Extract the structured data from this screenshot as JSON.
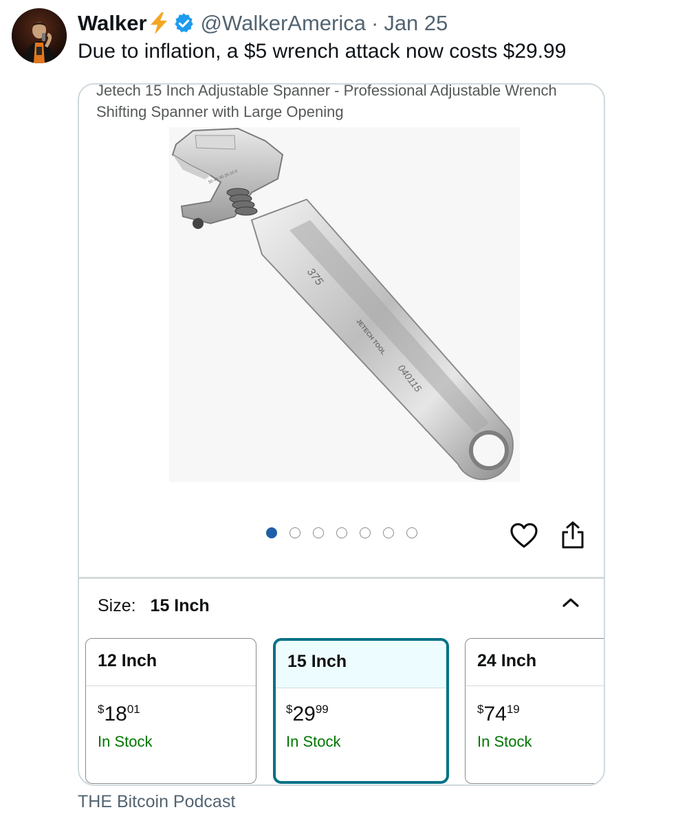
{
  "tweet": {
    "author_name": "Walker",
    "author_handle": "@WalkerAmerica",
    "separator": "·",
    "date": "Jan 25",
    "text": "Due to inflation, a $5 wrench attack now costs $29.99",
    "source": "THE Bitcoin Podcast"
  },
  "icons": {
    "name_emoji": "lightning-bolt-icon",
    "verified": "verified-badge-icon",
    "like": "heart-icon",
    "share": "share-icon",
    "collapse": "chevron-up-icon"
  },
  "product": {
    "title": "Jetech 15 Inch Adjustable Spanner - Professional Adjustable Wrench Shifting Spanner with Large Opening",
    "image_markings": [
      "375",
      "JETECH TOOL",
      "040115",
      "50 40 30 20 10 0"
    ],
    "gallery": {
      "total": 7,
      "active_index": 1
    },
    "size_label": "Size:",
    "selected_size": "15 Inch",
    "options": [
      {
        "name": "12 Inch",
        "currency": "$",
        "price_whole": "18",
        "price_cents": "01",
        "stock": "In Stock"
      },
      {
        "name": "15 Inch",
        "currency": "$",
        "price_whole": "29",
        "price_cents": "99",
        "stock": "In Stock"
      },
      {
        "name": "24 Inch",
        "currency": "$",
        "price_whole": "74",
        "price_cents": "19",
        "stock": "In Stock"
      }
    ]
  },
  "colors": {
    "verified_blue": "#1d9bf0",
    "bolt_orange": "#f5a623",
    "selected_border": "#007185",
    "selected_bg": "#edfdff",
    "in_stock_green": "#007600",
    "active_dot": "#1f5ea8",
    "secondary_text": "#536471"
  }
}
